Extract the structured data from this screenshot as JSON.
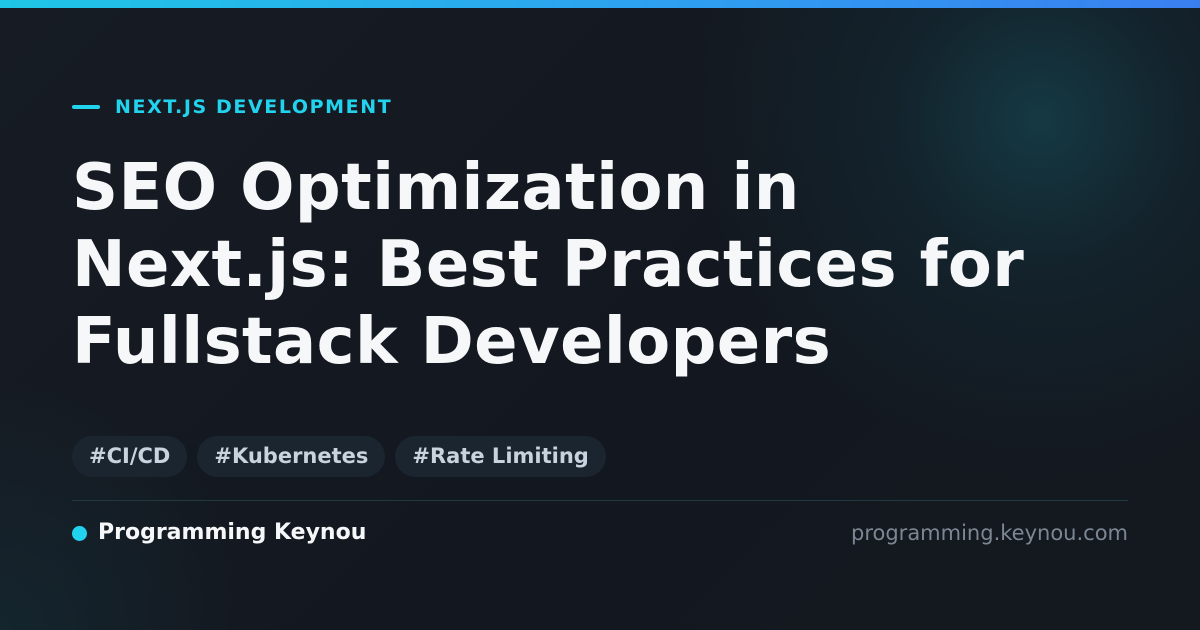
{
  "colors": {
    "accent": "#22d3ee",
    "background": "#13171f",
    "title": "#f6f7f9",
    "tag_background": "#1b2530",
    "tag_text": "#c9d3de",
    "url_text": "#7d8794"
  },
  "category": {
    "label": "NEXT.JS DEVELOPMENT"
  },
  "title": {
    "lines": [
      "SEO Optimization in",
      "Next.js: Best Practices for",
      "Fullstack Developers"
    ]
  },
  "tags": [
    "#CI/CD",
    "#Kubernetes",
    "#Rate Limiting"
  ],
  "footer": {
    "brand_name": "Programming Keynou",
    "site_url": "programming.keynou.com"
  }
}
